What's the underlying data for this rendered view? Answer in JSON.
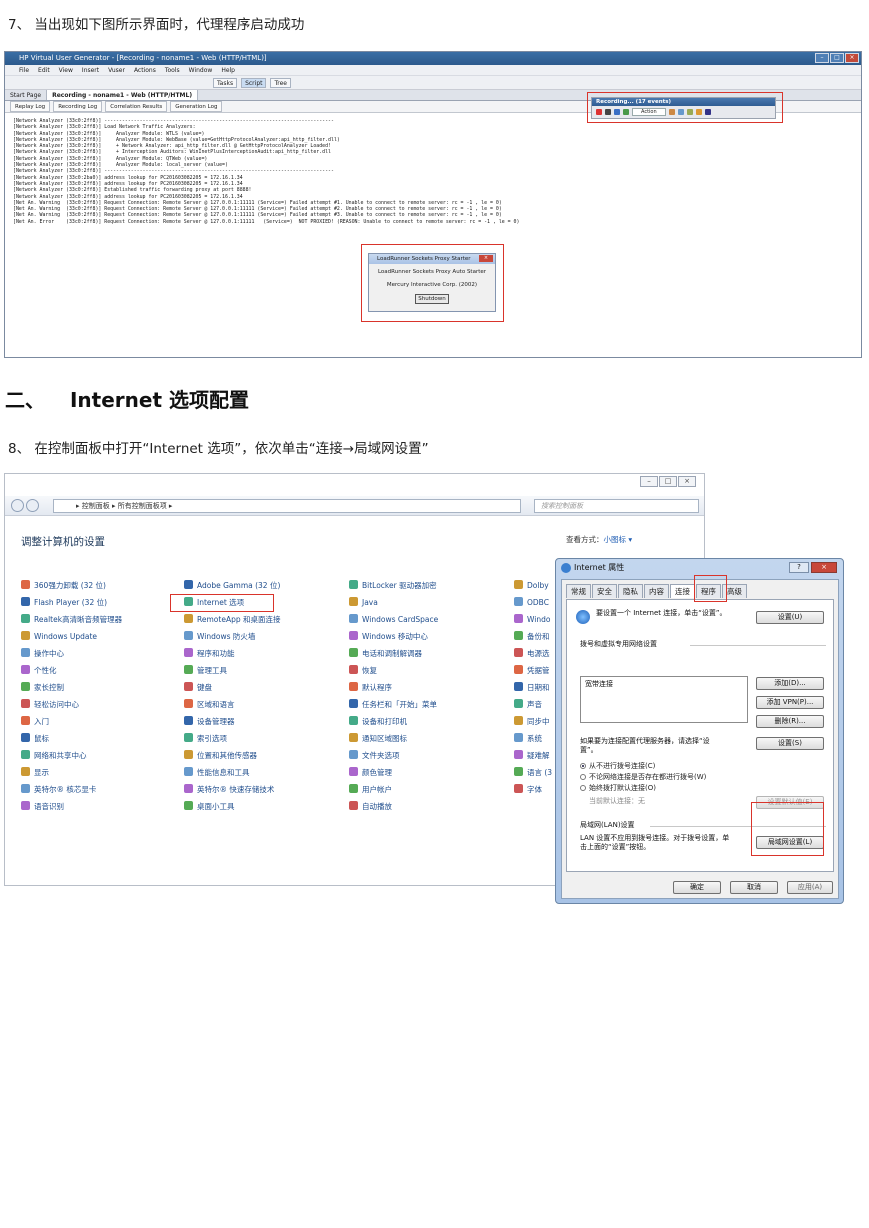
{
  "step7": {
    "text": "7、 当出现如下图所示界面时，代理程序启动成功"
  },
  "section2": {
    "number": "二、",
    "title": "Internet 选项配置"
  },
  "step8": {
    "text": "8、 在控制面板中打开“Internet 选项”，依次单击“连接→局域网设置”"
  },
  "vugen": {
    "title": "HP Virtual User Generator - [Recording - noname1 - Web (HTTP/HTML)]",
    "menu": [
      "File",
      "Edit",
      "View",
      "Insert",
      "Vuser",
      "Actions",
      "Tools",
      "Window",
      "Help"
    ],
    "toolbar": [
      "Tasks",
      "Script",
      "Tree"
    ],
    "tabs": [
      "Start Page",
      "Recording - noname1 - Web (HTTP/HTML)"
    ],
    "subtabs": [
      "Replay Log",
      "Recording Log",
      "Correlation Results",
      "Generation Log"
    ],
    "log": [
      "[Network Analyzer (33c0:2ff8)] ------------------------------------------------------------------------------",
      "[Network Analyzer (33c0:2ff8)] Load Network Traffic Analyzers:",
      "[Network Analyzer (33c0:2ff8)]     Analyzer Module: WTLS (value=)",
      "[Network Analyzer (33c0:2ff8)]     Analyzer Module: WebBase (value=GetHttpProtocolAnalyzer:api_http_filter.dll)",
      "[Network Analyzer (33c0:2ff8)]     + Network Analyzer: api_http_filter.dll @ GetHttpProtocolAnalyzer Loaded!",
      "[Network Analyzer (33c0:2ff8)]     + Interception Auditors: WinInetPlusInterceptionAudit:api_http_filter.dll",
      "[Network Analyzer (33c0:2ff8)]     Analyzer Module: QTWeb (value=)",
      "[Network Analyzer (33c0:2ff8)]     Analyzer Module: local_server (value=)",
      "[Network Analyzer (33c0:2ff8)] ------------------------------------------------------------------------------",
      "[Network Analyzer (33c0:2ba0)] address lookup for PC201603082205 = 172.16.1.34",
      "[Network Analyzer (33c0:2ff8)] address lookup for PC201603082205 = 172.16.1.34",
      "[Network Analyzer (33c0:2ff8)] Established traffic forwarding proxy at port 8888!",
      "[Network Analyzer (33c0:2ff8)] address lookup for PC201603082205 = 172.16.1.34",
      "[Net An. Warning  (33c0:2ff8)] Request Connection: Remote Server @ 127.0.0.1:11111 (Service=) Failed attempt #1. Unable to connect to remote server: rc = -1 , le = 0)",
      "[Net An. Warning  (33c0:2ff8)] Request Connection: Remote Server @ 127.0.0.1:11111 (Service=) Failed attempt #2. Unable to connect to remote server: rc = -1 , le = 0)",
      "[Net An. Warning  (33c0:2ff8)] Request Connection: Remote Server @ 127.0.0.1:11111 (Service=) Failed attempt #3. Unable to connect to remote server: rc = -1 , le = 0)",
      "[Net An. Error    (33c0:2ff8)] Request Connection: Remote Server @ 127.0.0.1:11111   (Service=)  NOT PROXIED! (REASON: Unable to connect to remote server: rc = -1 , le = 0)"
    ],
    "recording": {
      "title": "Recording... (17 events)",
      "action": "Action"
    },
    "proxy": {
      "title": "LoadRunner Sockets Proxy Starter",
      "line1": "LoadRunner Sockets Proxy Auto Starter",
      "line2": "Mercury Interactive Corp. (2002)",
      "button": "Shutdown"
    }
  },
  "cp": {
    "address": "▸ 控制面板 ▸ 所有控制面板项 ▸",
    "search": "搜索控制面板",
    "heading": "调整计算机的设置",
    "view_label": "查看方式：",
    "view_value": "小图标 ▾",
    "col1": [
      "360强力卸载 (32 位)",
      "Flash Player (32 位)",
      "Realtek高清晰音频管理器",
      "Windows Update",
      "操作中心",
      "个性化",
      "家长控制",
      "轻松访问中心",
      "入门",
      "鼠标",
      "网络和共享中心",
      "显示",
      "英特尔® 核芯显卡",
      "语音识别"
    ],
    "col2": [
      "Adobe Gamma (32 位)",
      "Internet 选项",
      "RemoteApp 和桌面连接",
      "Windows 防火墙",
      "程序和功能",
      "管理工具",
      "键盘",
      "区域和语言",
      "设备管理器",
      "索引选项",
      "位置和其他传感器",
      "性能信息和工具",
      "英特尔® 快速存储技术",
      "桌面小工具"
    ],
    "col3": [
      "BitLocker 驱动器加密",
      "Java",
      "Windows CardSpace",
      "Windows 移动中心",
      "电话和调制解调器",
      "恢复",
      "默认程序",
      "任务栏和「开始」菜单",
      "设备和打印机",
      "通知区域图标",
      "文件夹选项",
      "颜色管理",
      "用户帐户",
      "自动播放"
    ],
    "col4": [
      "Dolby",
      "ODBC",
      "Windo",
      "备份和",
      "电源选",
      "凭据管",
      "日期和",
      "声音",
      "同步中",
      "系统",
      "疑难解",
      "语言 (3",
      "字体"
    ]
  },
  "io": {
    "title": "Internet 属性",
    "help": "?",
    "tabs": [
      "常规",
      "安全",
      "隐私",
      "内容",
      "连接",
      "程序",
      "高级"
    ],
    "setup_text": "要设置一个 Internet 连接，单击“设置”。",
    "setup_btn": "设置(U)",
    "dialup_label": "拨号和虚拟专用网络设置",
    "dialup_item": "宽带连接",
    "add_btn": "添加(D)...",
    "addvpn_btn": "添加 VPN(P)...",
    "remove_btn": "删除(R)...",
    "proxy_text": "如果要为连接配置代理服务器，请选择“设置”。",
    "settings_btn": "设置(S)",
    "radio1": "从不进行拨号连接(C)",
    "radio2": "不论网络连接是否存在都进行拨号(W)",
    "radio3": "始终拨打默认连接(O)",
    "current_label": "当前默认连接：",
    "current_value": "无",
    "default_btn": "设置默认值(E)",
    "lan_label": "局域网(LAN)设置",
    "lan_text": "LAN 设置不应用到拨号连接。对于拨号设置，单击上面的“设置”按钮。",
    "lan_btn": "局域网设置(L)",
    "ok": "确定",
    "cancel": "取消",
    "apply": "应用(A)"
  }
}
